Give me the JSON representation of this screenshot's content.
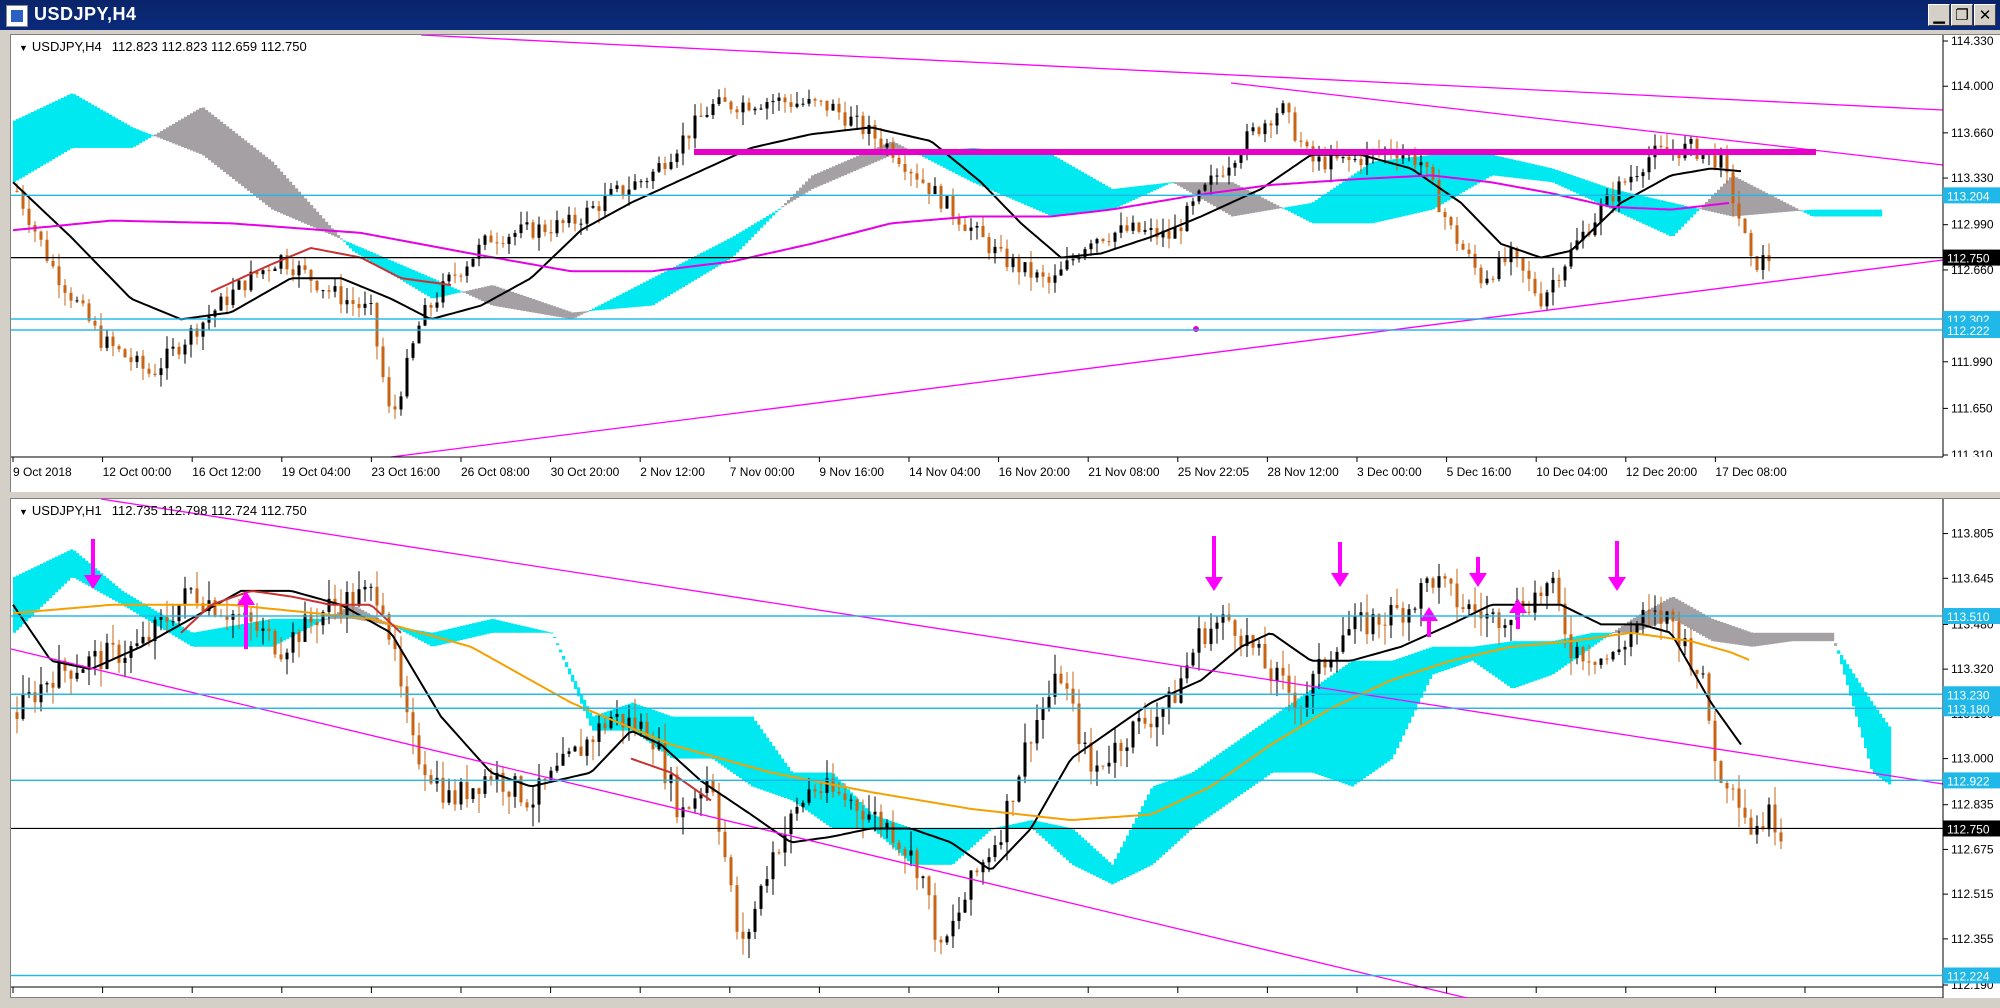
{
  "window": {
    "title": "USDJPY,H4",
    "buttons": [
      "▁",
      "❐",
      "✕"
    ]
  },
  "h4": {
    "symbol": "USDJPY,H4",
    "ohlc": "112.823 112.823 112.659 112.750",
    "ylim": [
      111.31,
      114.33
    ],
    "price_ticks": [
      "114.330",
      "114.000",
      "113.660",
      "113.330",
      "112.990",
      "112.660",
      "112.320",
      "111.990",
      "111.650",
      "111.310"
    ],
    "date_ticks": [
      "9 Oct 2018",
      "12 Oct 00:00",
      "16 Oct 12:00",
      "19 Oct 04:00",
      "23 Oct 16:00",
      "26 Oct 08:00",
      "30 Oct 20:00",
      "2 Nov 12:00",
      "7 Nov 00:00",
      "9 Nov 16:00",
      "14 Nov 04:00",
      "16 Nov 20:00",
      "21 Nov 08:00",
      "25 Nov 22:05",
      "28 Nov 12:00",
      "3 Dec 00:00",
      "5 Dec 16:00",
      "10 Dec 04:00",
      "12 Dec 20:00",
      "17 Dec 08:00"
    ],
    "levels": [
      {
        "label": "113.204",
        "value": 113.204
      },
      {
        "label": "112.302",
        "value": 112.302
      },
      {
        "label": "112.222",
        "value": 112.222
      }
    ],
    "current": {
      "label": "112.750",
      "value": 112.75
    }
  },
  "h1": {
    "symbol": "USDJPY,H1",
    "ohlc": "112.735 112.798 112.724 112.750",
    "ylim": [
      112.19,
      113.9
    ],
    "price_ticks": [
      "113.805",
      "113.645",
      "113.480",
      "113.320",
      "113.160",
      "113.000",
      "112.835",
      "112.675",
      "112.515",
      "112.355",
      "112.190"
    ],
    "levels": [
      {
        "label": "113.510",
        "value": 113.51
      },
      {
        "label": "113.230",
        "value": 113.23
      },
      {
        "label": "113.180",
        "value": 113.18
      },
      {
        "label": "112.922",
        "value": 112.922
      },
      {
        "label": "112.224",
        "value": 112.224
      }
    ],
    "current": {
      "label": "112.750",
      "value": 112.75
    }
  },
  "colors": {
    "bull": "#000000",
    "bear": "#c86414",
    "cloud_up": "#00e8f0",
    "cloud_down": "#a4a0a4",
    "trend": "#ff00ff",
    "level": "#20b8e8",
    "ma_fast": "#000000",
    "ma_slow_h4": "#e600e6",
    "ma_slow_h1": "#f5a000",
    "kijun": "#c83232"
  }
}
